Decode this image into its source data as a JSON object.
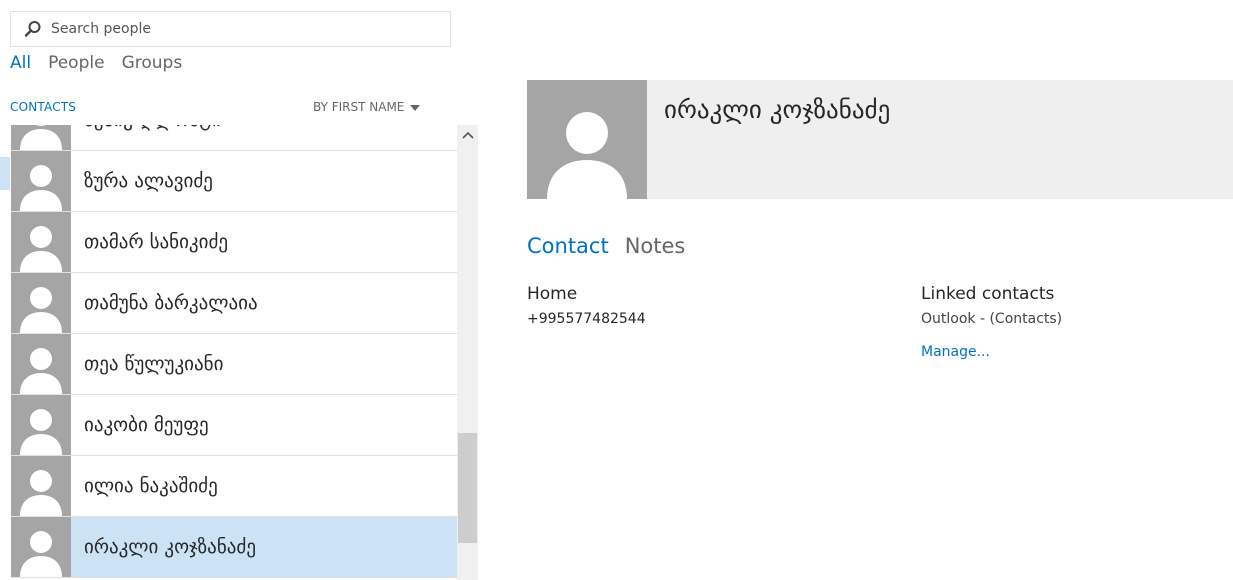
{
  "search": {
    "placeholder": "Search people",
    "value": ""
  },
  "filters": [
    {
      "label": "All",
      "active": true
    },
    {
      "label": "People",
      "active": false
    },
    {
      "label": "Groups",
      "active": false
    }
  ],
  "list_header": {
    "label": "CONTACTS",
    "sort_label": "BY FIRST NAME"
  },
  "contacts": [
    {
      "name": "ბესიკ ღლონტი",
      "selected": false
    },
    {
      "name": "ზურა ალავიძე",
      "selected": false
    },
    {
      "name": "თამარ სანიკიძე",
      "selected": false
    },
    {
      "name": "თამუნა ბარკალაია",
      "selected": false
    },
    {
      "name": "თეა წულუკიანი",
      "selected": false
    },
    {
      "name": "იაკობი მეუფე",
      "selected": false
    },
    {
      "name": "ილია ნაკაშიძე",
      "selected": false
    },
    {
      "name": "ირაკლი კოჯზანაძე",
      "selected": true
    }
  ],
  "detail": {
    "name": "ირაკლი კოჯზანაძე",
    "tabs": [
      {
        "label": "Contact",
        "active": true
      },
      {
        "label": "Notes",
        "active": false
      }
    ],
    "phone": {
      "label": "Home",
      "value": "+995577482544"
    },
    "linked": {
      "label": "Linked contacts",
      "source": "Outlook - (Contacts)",
      "manage": "Manage..."
    }
  },
  "colors": {
    "accent": "#0072c6",
    "selected_row": "#cce3f6",
    "avatar_bg": "#a5a5a5",
    "header_band": "#efefef"
  },
  "icons": {
    "search": "search-icon",
    "avatar": "person-silhouette-icon",
    "sort": "caret-down-icon",
    "scroll_up": "chevron-up-icon"
  }
}
